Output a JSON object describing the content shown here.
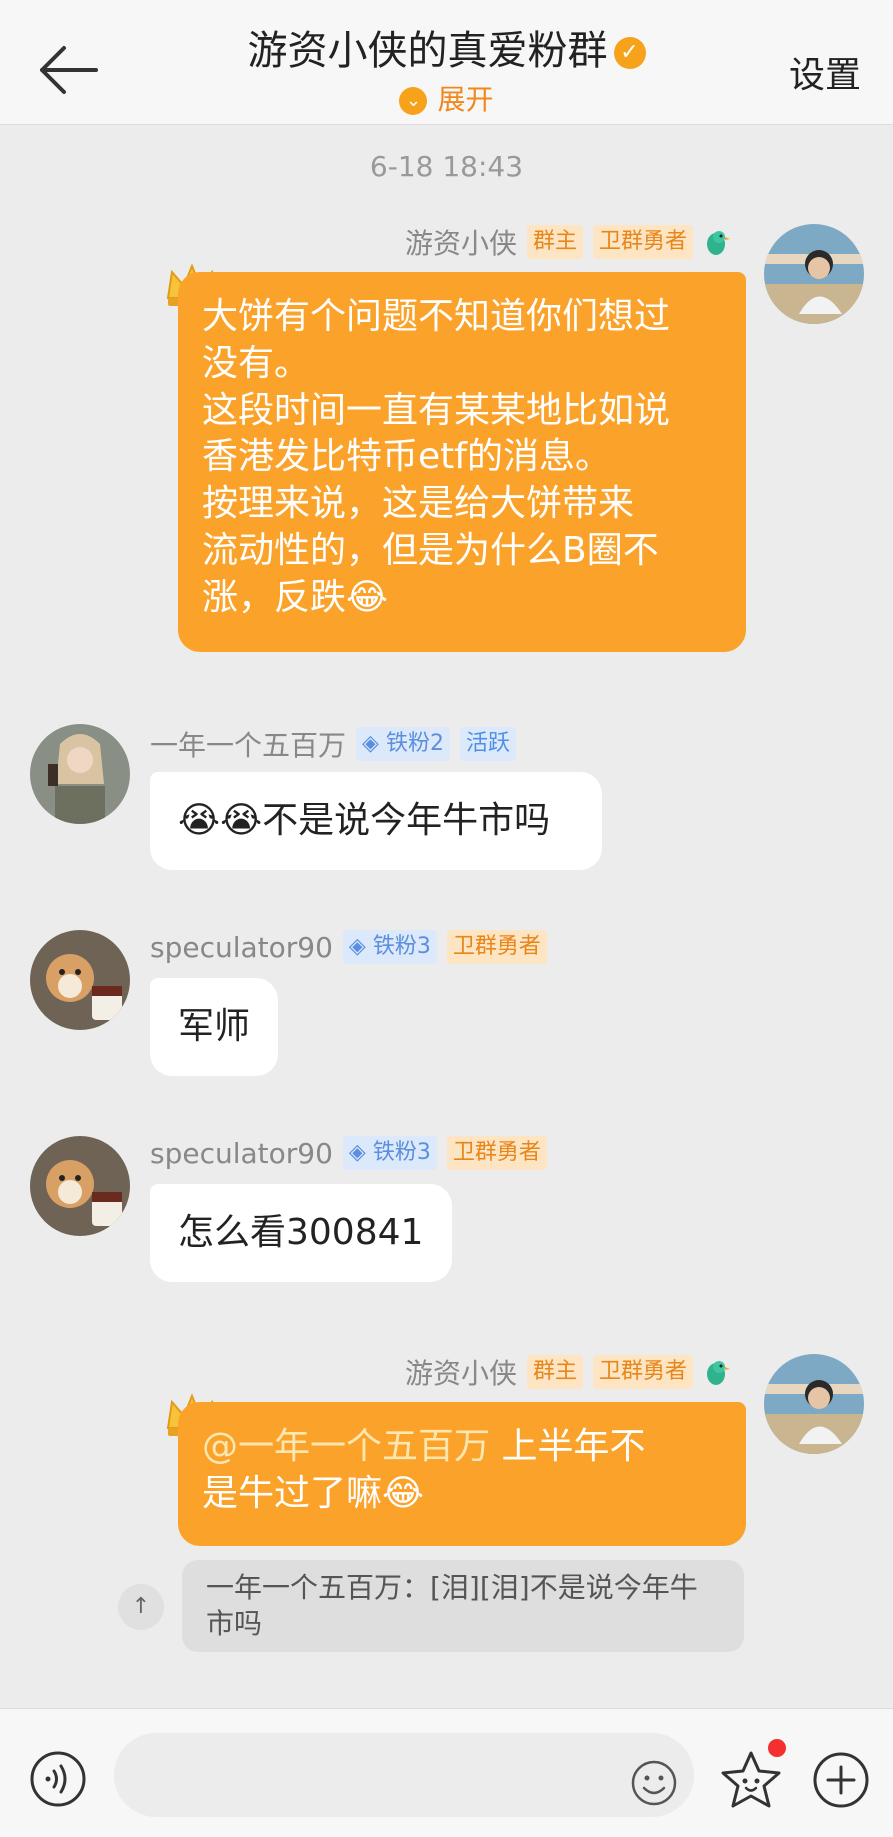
{
  "header": {
    "title": "游资小侠的真爱粉群",
    "expand_label": "展开",
    "settings_label": "设置"
  },
  "timestamp": "6-18 18:43",
  "messages": [
    {
      "sender": "游资小侠",
      "tags": [
        "群主",
        "卫群勇者"
      ],
      "lines": [
        "大饼有个问题不知道你们想过",
        "没有。",
        "这段时间一直有某某地比如说",
        "香港发比特币etf的消息。",
        "按理来说，这是给大饼带来",
        "流动性的，但是为什么B圈不",
        "涨，反跌😂"
      ]
    },
    {
      "sender": "一年一个五百万",
      "tags": [
        "铁粉2",
        "活跃"
      ],
      "text": "😭😭不是说今年牛市吗"
    },
    {
      "sender": "speculator90",
      "tags": [
        "铁粉3",
        "卫群勇者"
      ],
      "text": "军师"
    },
    {
      "sender": "speculator90",
      "tags": [
        "铁粉3",
        "卫群勇者"
      ],
      "text": "怎么看300841"
    },
    {
      "sender": "游资小侠",
      "tags": [
        "群主",
        "卫群勇者"
      ],
      "mention": "@一年一个五百万",
      "lines": [
        "上半年不",
        "是牛过了嘛😂"
      ],
      "quote": "一年一个五百万：[泪][泪]不是说今年牛市吗"
    }
  ],
  "input": {
    "placeholder": ""
  },
  "colors": {
    "bubble_orange": "#fba22b",
    "accent": "#f7a21b"
  }
}
